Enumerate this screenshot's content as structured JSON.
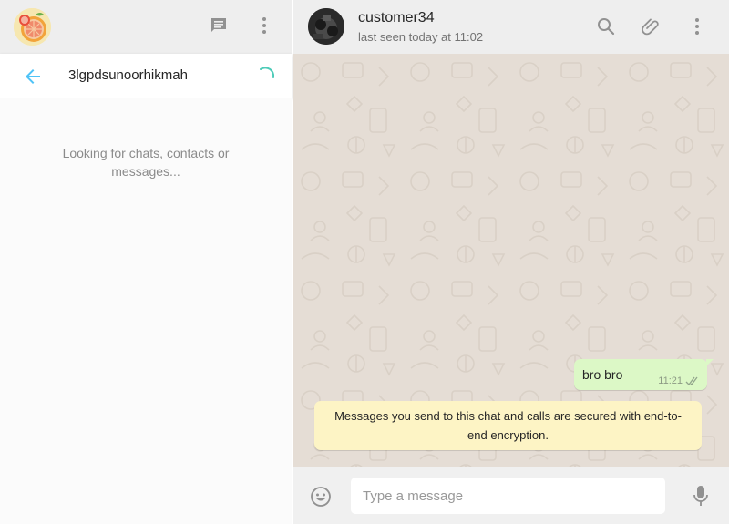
{
  "sidebar": {
    "header": {
      "avatar_icon": "grapefruit-avatar",
      "new_chat_icon": "message-icon",
      "menu_icon": "more-vertical-icon"
    },
    "search": {
      "query": "3lgpdsunoorhikmah",
      "back_icon": "back-arrow-icon",
      "loading_icon": "spinner-icon"
    },
    "status_text": "Looking for chats, contacts or messages..."
  },
  "chat": {
    "contact": {
      "name": "customer34",
      "status": "last seen today at 11:02"
    },
    "header_icons": [
      "search-icon",
      "attach-icon",
      "more-vertical-icon"
    ],
    "messages": [
      {
        "direction": "outgoing",
        "text": "bro bro",
        "time": "11:21",
        "ticks": "double-check"
      }
    ],
    "encryption_notice": "Messages you send to this chat and calls are secured with end-to-end encryption.",
    "composer": {
      "placeholder": "Type a message",
      "emoji_icon": "emoji-icon",
      "mic_icon": "mic-icon"
    }
  },
  "colors": {
    "accent": "#4fc3f7",
    "header_bg": "#eeeeee",
    "chat_bg": "#e5ddd5",
    "outgoing_bubble": "#dcf8c6",
    "notice_bg": "#fdf4c5",
    "icon_gray": "#919191"
  }
}
